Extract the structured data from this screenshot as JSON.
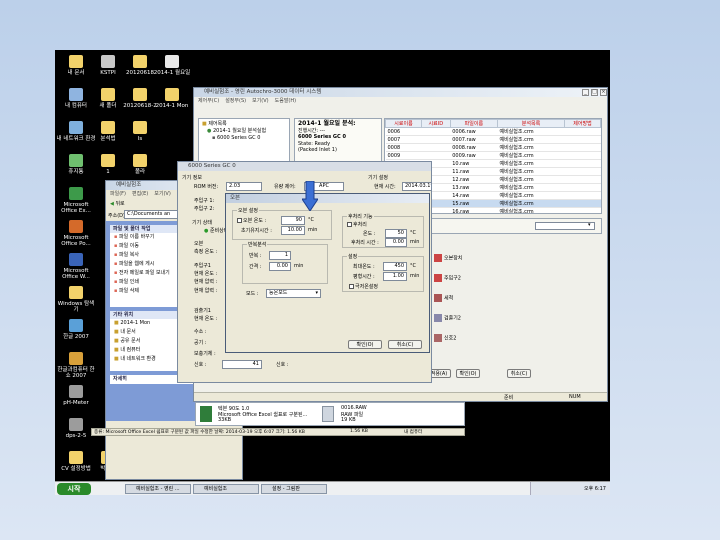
{
  "desktop_icons": [
    {
      "label": "내 문서",
      "col": 0,
      "row": 0,
      "color": "#f2d26b"
    },
    {
      "label": "KSTPI",
      "col": 1,
      "row": 0,
      "color": "#c7c7c7"
    },
    {
      "label": "20120618",
      "col": 2,
      "row": 0,
      "color": "#f2d26b"
    },
    {
      "label": "2014-1 월요일",
      "col": 3,
      "row": 0,
      "color": "#e8e8e8"
    },
    {
      "label": "내 컴퓨터",
      "col": 0,
      "row": 1,
      "color": "#8fb4e0"
    },
    {
      "label": "새 폴더",
      "col": 1,
      "row": 1,
      "color": "#f2d26b"
    },
    {
      "label": "20120618-2",
      "col": 2,
      "row": 1,
      "color": "#f2d26b"
    },
    {
      "label": "2014-1 Mon",
      "col": 3,
      "row": 1,
      "color": "#f2d26b"
    },
    {
      "label": "내 네트워크 환경",
      "col": 0,
      "row": 2,
      "color": "#7fb0dd"
    },
    {
      "label": "분석법",
      "col": 1,
      "row": 2,
      "color": "#f2d26b"
    },
    {
      "label": "ls",
      "col": 2,
      "row": 2,
      "color": "#f2d26b"
    },
    {
      "label": "휴지통",
      "col": 0,
      "row": 3,
      "color": "#6fbf6f"
    },
    {
      "label": "1",
      "col": 1,
      "row": 3,
      "color": "#f2d26b"
    },
    {
      "label": "폴라",
      "col": 2,
      "row": 3,
      "color": "#f2d26b"
    },
    {
      "label": "Microsoft Office Ex...",
      "col": 0,
      "row": 4,
      "color": "#3d9a4a"
    },
    {
      "label": "Microsoft Office Po...",
      "col": 0,
      "row": 5,
      "color": "#d46a2a"
    },
    {
      "label": "Microsoft Office W...",
      "col": 0,
      "row": 6,
      "color": "#3a64b8"
    },
    {
      "label": "Windows 탐색기",
      "col": 0,
      "row": 7,
      "color": "#f2d26b"
    },
    {
      "label": "한글 2007",
      "col": 0,
      "row": 8,
      "color": "#5aa0d8"
    },
    {
      "label": "한글과컴퓨터 한쇼 2007",
      "col": 0,
      "row": 9,
      "color": "#d8a03a"
    },
    {
      "label": "pH-Meter",
      "col": 0,
      "row": 10,
      "color": "#9c9c9c"
    },
    {
      "label": "dps-2-5",
      "col": 0,
      "row": 11,
      "color": "#9c9c9c"
    },
    {
      "label": "CV 설정방법",
      "col": 0,
      "row": 12,
      "color": "#f2d26b"
    },
    {
      "label": "박은지",
      "col": 1,
      "row": 12,
      "color": "#f2d26b"
    },
    {
      "label": "2014-1학 분석실험",
      "col": 2,
      "row": 12,
      "color": "#f2d26b"
    }
  ],
  "taskbar": {
    "start_label": "시작",
    "buttons": [
      "예비실험조 - 영린 ...",
      "예비실험조",
      "설정 - 그림판"
    ],
    "clock": "오후 6:17"
  },
  "explorer": {
    "title": "예비실험조",
    "menu": [
      "파일(F)",
      "편집(E)",
      "보기(V)"
    ],
    "back_label": "뒤로",
    "address_label": "주소(D)",
    "address_value": "C:\\Documents an",
    "tasks_header": "파일 및 폴더 작업",
    "tasks": [
      "파일 이름 바꾸기",
      "파일 이동",
      "파일 복사",
      "파일을 웹에 게시",
      "전자 메일로 파일 보내기",
      "파일 인쇄",
      "파일 삭제"
    ],
    "places_header": "기타 위치",
    "places": [
      "2014-1 Mon",
      "내 문서",
      "공유 문서",
      "내 컴퓨터",
      "내 네트워크 환경"
    ],
    "details_header": "자세히",
    "file1_name": "텍본 90도 1.0",
    "file1_desc": "Microsoft Office Excel 쉼표로 구분된...",
    "file1_size": "33KB",
    "file2_name": "0016.RAW",
    "file2_desc": "RAW 파일",
    "file2_size": "19 KB",
    "status_text": "종류: Microsoft Office Excel 쉼표로 구분된 값 파일 수정한 날짜: 2014-03-19 오후 6:07 크기: 1.56 KB",
    "status_size": "1.56 KB",
    "status_location": "내 컴퓨터"
  },
  "autochro": {
    "title": "예비실험조 - 영린 Autochro-3000 데이터 시스템",
    "menu": [
      "제어부(C)",
      "설정부(S)",
      "보기(V)",
      "도움말(H)"
    ],
    "tree": [
      "제어목록",
      "2014-1 월요일 분석실험",
      "6000 Series GC 0"
    ],
    "run_title": "2014-1 월요일 분석:",
    "run_lines": [
      "진행시간: ---",
      "6000 Series GC 0",
      "State: Ready",
      "(Packed Inlet 1)"
    ],
    "table_headers": [
      "시료이름",
      "시료ID",
      "파일이름",
      "분석목록",
      "제어방법"
    ],
    "rows": [
      [
        "0006",
        "",
        "0006.raw",
        "예비실험조.crm",
        ""
      ],
      [
        "0007",
        "",
        "0007.raw",
        "예비실험조.crm",
        ""
      ],
      [
        "0008",
        "",
        "0008.raw",
        "예비실험조.crm",
        ""
      ],
      [
        "0009",
        "",
        "0009.raw",
        "예비실험조.crm",
        ""
      ],
      [
        "",
        "",
        "10.raw",
        "예비실험조.crm",
        ""
      ],
      [
        "",
        "",
        "11.raw",
        "예비실험조.crm",
        ""
      ],
      [
        "",
        "",
        "12.raw",
        "예비실험조.crm",
        ""
      ],
      [
        "",
        "",
        "13.raw",
        "예비실험조.crm",
        ""
      ],
      [
        "",
        "",
        "14.raw",
        "예비실험조.crm",
        ""
      ],
      [
        "",
        "",
        "15.raw",
        "예비실험조.crm",
        ""
      ],
      [
        "",
        "",
        "16.raw",
        "예비실험조.crm",
        ""
      ]
    ],
    "selected_row": 9,
    "side_items": [
      "오븐장치",
      "주입구2",
      "세척",
      "검출기2",
      "신호2"
    ],
    "bottom_buttons": [
      "적용(A)",
      "확인(O)",
      "취소(C)"
    ],
    "status_ready": "준비",
    "status_num": "NUM"
  },
  "gc": {
    "title": "6000 Series GC 0",
    "device_info_label": "기기 정보",
    "rom_label": "ROM 버전:",
    "rom_value": "2.03",
    "flow_label": "유량 제어:",
    "flow_value": "APC",
    "inj1_label": "주입구 1:",
    "inj2_label": "주입구 2:",
    "state_label": "기기 상태",
    "state_value": "준비상태",
    "oven_label": "오븐",
    "oven_temp_label": "측정 온도 :",
    "inj_group_label": "주입구1",
    "cur_temp_label": "현재 온도 :",
    "cur_pressure_label": "현재 압력 :",
    "det_group_label": "검출기1",
    "h2_label": "수소 :",
    "air_label": "공기 :",
    "makeup_label": "보충기체 :",
    "signal_label": "신호 :",
    "signal_value": "41",
    "signal2_label": "신호 :",
    "settings_label": "기기 설정",
    "cur_time_label": "현재 시간:",
    "cur_time_value": "2014.03.19 - 18:11:13"
  },
  "oven_dialog": {
    "title": "오븐",
    "oven_setting_group": "오븐 설정",
    "oven_temp_label": "오븐 온도 :",
    "oven_temp_value": "90",
    "oven_temp_unit": "°C",
    "init_time_label": "초기유지시간 :",
    "init_time_value": "10.00",
    "init_time_unit": "min",
    "post_group": "후처리 기능",
    "post_check_label": "후처리",
    "post_temp_label": "온도 :",
    "post_temp_value": "50",
    "post_temp_unit": "°C",
    "post_time_label": "후처리 시간 :",
    "post_time_value": "0.00",
    "post_time_unit": "min",
    "repeat_group": "반복분석",
    "repeat_count_label": "반복 :",
    "repeat_count_value": "1",
    "interval_label": "간격 :",
    "interval_value": "0.00",
    "interval_unit": "min",
    "mode_label": "모드 :",
    "mode_value": "등온모드",
    "setting_group": "설정",
    "max_temp_label": "최대온도 :",
    "max_temp_value": "450",
    "max_temp_unit": "°C",
    "eq_time_label": "평형시간 :",
    "eq_time_value": "1.00",
    "eq_time_unit": "min",
    "cryo_label": "극저온설정",
    "ok_label": "확인(O)",
    "cancel_label": "취소(C)"
  },
  "colors": {
    "arrow": "#3b6fd4",
    "arrow_outline": "#1e3f8a",
    "screen_bg": "#000000",
    "slide_bg": "#c9d8ee"
  }
}
